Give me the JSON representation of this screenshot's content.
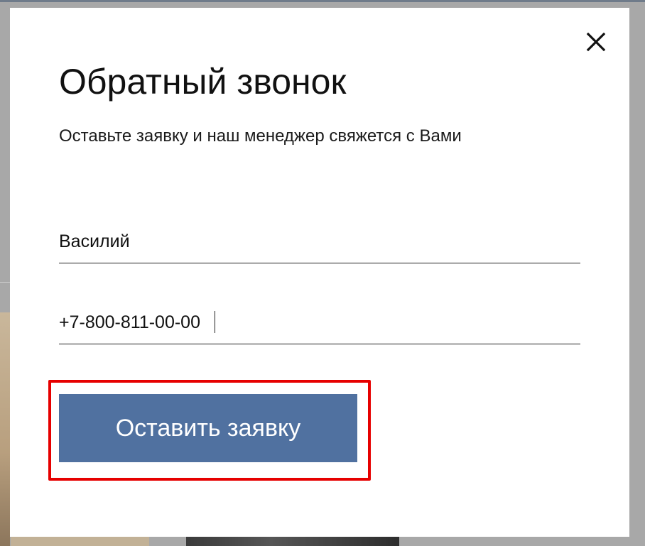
{
  "dialog": {
    "title": "Обратный звонок",
    "subtitle": "Оставьте заявку и наш менеджер свяжется с Вами",
    "close_icon": "close-icon"
  },
  "form": {
    "name_value": "Василий",
    "phone_value": "+7-800-811-00-00",
    "submit_label": "Оставить заявку"
  },
  "colors": {
    "button_background": "#5071a0",
    "highlight_border": "#e60000",
    "overlay": "#a8a8a8"
  }
}
